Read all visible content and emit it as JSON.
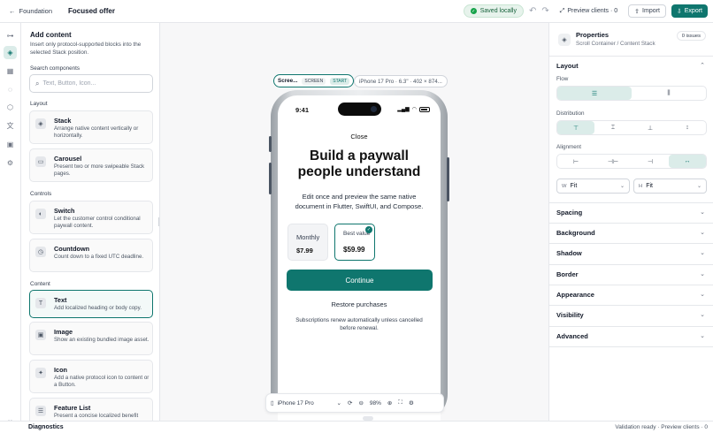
{
  "topbar": {
    "back_label": "Foundation",
    "title": "Focused offer",
    "saved_label": "Saved locally",
    "preview_label": "Preview clients · 0",
    "import_label": "Import",
    "export_label": "Export"
  },
  "rail": {
    "icons": [
      "flow-icon",
      "layers-icon",
      "grid-icon",
      "chat-icon",
      "package-icon",
      "translate-icon",
      "image-icon",
      "settings-icon"
    ],
    "active": "layers-icon",
    "bottom_icon": "diagnostics-icon"
  },
  "left_panel": {
    "title": "Add content",
    "subtitle": "Insert only protocol-supported blocks into the selected Stack position.",
    "search_label": "Search components",
    "search_placeholder": "Text, Button, Icon...",
    "sections": {
      "layout": "Layout",
      "controls": "Controls",
      "content": "Content"
    },
    "cards": {
      "stack": {
        "title": "Stack",
        "desc": "Arrange native content vertically or horizontally."
      },
      "carousel": {
        "title": "Carousel",
        "desc": "Present two or more swipeable Stack pages."
      },
      "switch": {
        "title": "Switch",
        "desc": "Let the customer control conditional paywall content."
      },
      "countdown": {
        "title": "Countdown",
        "desc": "Count down to a fixed UTC deadline."
      },
      "text": {
        "title": "Text",
        "desc": "Add localized heading or body copy."
      },
      "image": {
        "title": "Image",
        "desc": "Show an existing bundled image asset."
      },
      "icon": {
        "title": "Icon",
        "desc": "Add a native protocol icon to content or a Button."
      },
      "feature_list": {
        "title": "Feature List",
        "desc": "Present a concise localized benefit"
      }
    }
  },
  "canvas": {
    "screen_chip": {
      "label": "Scree...",
      "tag1": "SCREEN",
      "tag2": "START"
    },
    "device_chip": "iPhone 17 Pro · 6.3\" · 402 × 874...",
    "phone": {
      "time": "9:41",
      "close": "Close",
      "headline": "Build a paywall people understand",
      "body": "Edit once and preview the same native document in Flutter, SwiftUI, and Compose.",
      "plans": [
        {
          "name": "Monthly",
          "price": "$7.99"
        },
        {
          "name": "Best value",
          "price": "$59.99"
        }
      ],
      "cta": "Continue",
      "restore": "Restore purchases",
      "fineprint": "Subscriptions renew automatically unless cancelled before renewal."
    },
    "zoom": {
      "device": "iPhone 17 Pro",
      "level": "98%"
    }
  },
  "right_panel": {
    "title": "Properties",
    "subtitle": "Scroll Container / Content Stack",
    "issues": "0 issues",
    "layout": {
      "title": "Layout",
      "flow_label": "Flow",
      "distribution_label": "Distribution",
      "alignment_label": "Alignment",
      "width": {
        "prefix": "W",
        "value": "Fit"
      },
      "height": {
        "prefix": "H",
        "value": "Fit"
      }
    },
    "sections": [
      "Spacing",
      "Background",
      "Shadow",
      "Border",
      "Appearance",
      "Visibility",
      "Advanced"
    ]
  },
  "bottombar": {
    "diagnostics": "Diagnostics",
    "status": "Validation ready · Preview clients · 0"
  },
  "colors": {
    "accent": "#0f766e",
    "accent_light": "#dbece9",
    "saved_bg": "#e7f3ec"
  }
}
